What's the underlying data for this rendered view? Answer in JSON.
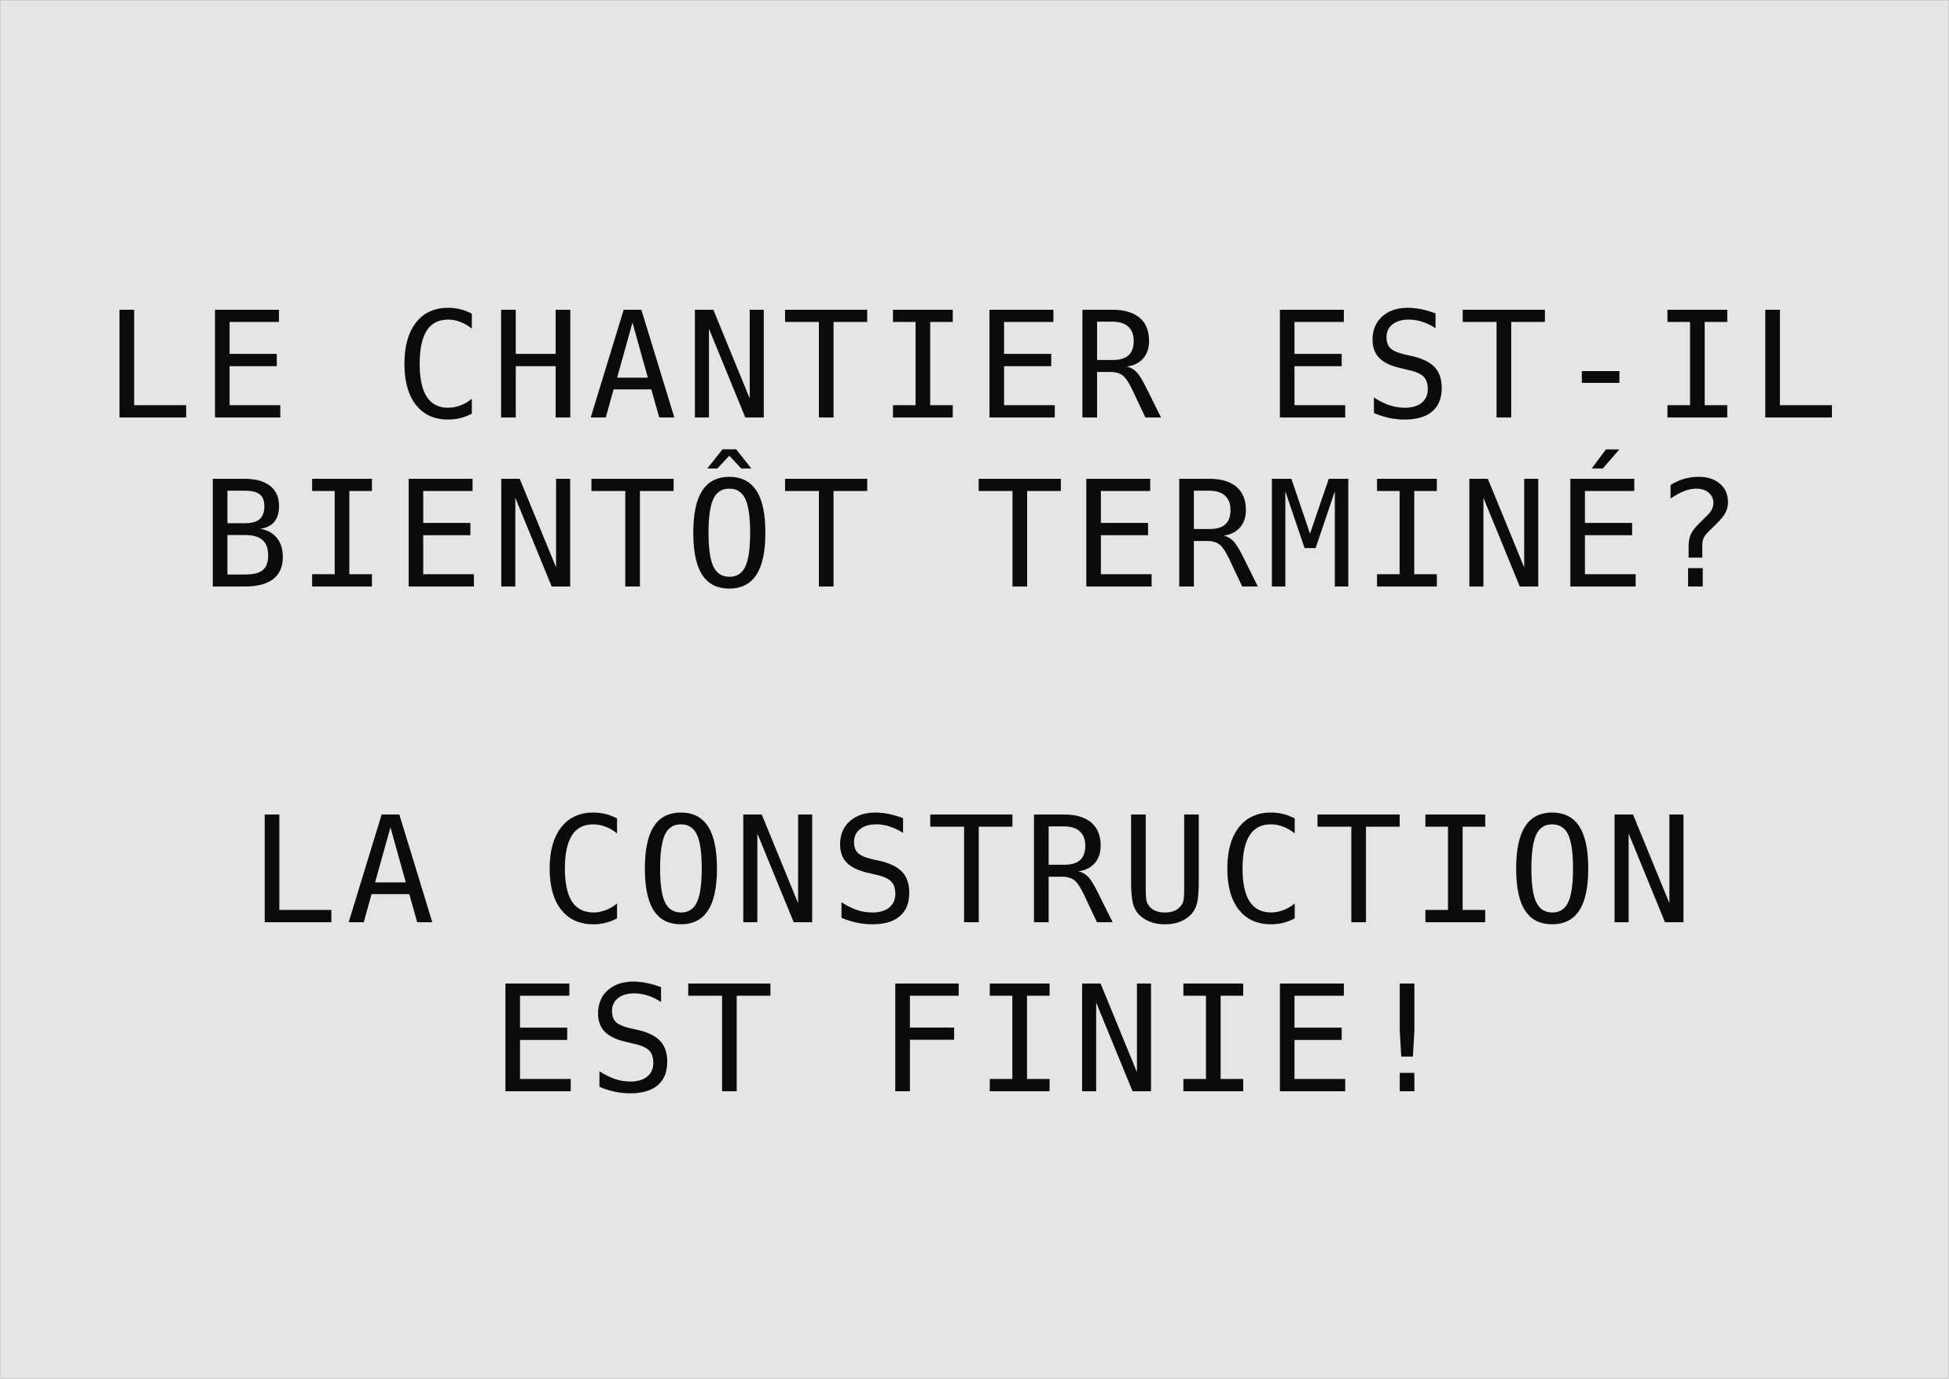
{
  "question": {
    "line1": "LE CHANTIER EST-IL",
    "line2": "BIENTÔT TERMINÉ?"
  },
  "answer": {
    "line1": "LA CONSTRUCTION",
    "line2": "EST FINIE!"
  },
  "colors": {
    "background": "#e5e5e5",
    "text": "#0b0b0b"
  }
}
